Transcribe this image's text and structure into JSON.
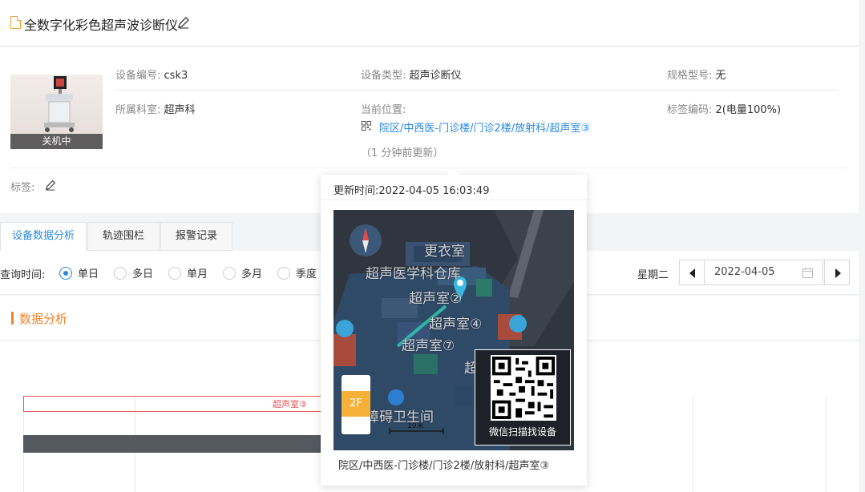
{
  "header": {
    "title": "全数字化彩色超声波诊断仪"
  },
  "device": {
    "status": "关机中",
    "fields": {
      "code_label": "设备编号:",
      "code": "csk3",
      "type_label": "设备类型:",
      "type": "超声诊断仪",
      "model_label": "规格型号:",
      "model": "无",
      "dept_label": "所属科室:",
      "dept": "超声科",
      "location_label": "当前位置:",
      "location": "院区/中西医-门诊楼/门诊2楼/放射科/超声室③",
      "tagcode_label": "标签编码:",
      "tagcode": "2(电量100%)",
      "updated": "（1 分钟前更新）",
      "tags_label": "标签:"
    }
  },
  "tabs": [
    {
      "label": "设备数据分析",
      "active": true
    },
    {
      "label": "轨迹围栏",
      "active": false
    },
    {
      "label": "报警记录",
      "active": false
    }
  ],
  "query": {
    "label": "查询时间:",
    "options": [
      {
        "label": "单日",
        "selected": true
      },
      {
        "label": "多日",
        "selected": false
      },
      {
        "label": "单月",
        "selected": false
      },
      {
        "label": "多月",
        "selected": false
      },
      {
        "label": "季度",
        "selected": false
      }
    ],
    "weekday": "星期二",
    "date": "2022-04-05"
  },
  "analysis": {
    "title": "数据分析",
    "segment_label": "超声室③"
  },
  "popup": {
    "time_label": "更新时间:",
    "time": "2022-04-05 16:03:49",
    "address": "院区/中西医-门诊楼/门诊2楼/放射科/超声室③",
    "map": {
      "labels": [
        "更衣室",
        "超声医学科仓库",
        "超声室②",
        "超声室④",
        "超声室⑦",
        "超声",
        "障碍卫生间"
      ],
      "floor": "2F",
      "scale": "10米",
      "qr_caption": "微信扫描找设备"
    }
  },
  "colors": {
    "accent": "#2a8ae0",
    "orange": "#f0832a",
    "alarm": "#e65555"
  }
}
